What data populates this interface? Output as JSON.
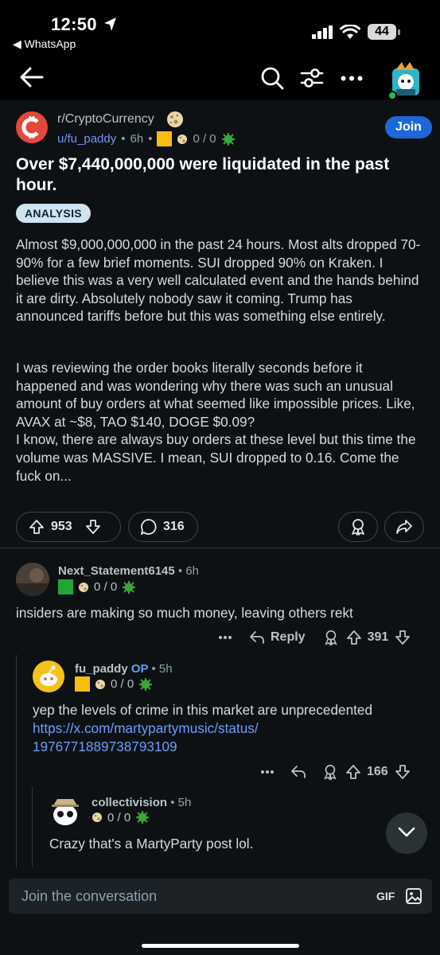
{
  "status_bar": {
    "time": "12:50",
    "back_app": "WhatsApp",
    "battery": "44"
  },
  "post": {
    "subreddit": "r/CryptoCurrency",
    "author": "u/fu_paddy",
    "age": "6h",
    "karma_flair": "0 / 0",
    "join_label": "Join",
    "title": "Over $7,440,000,000 were liquidated in the past hour.",
    "flair": "ANALYSIS",
    "paragraph_1": "Almost $9,000,000,000 in the past 24 hours. Most alts dropped 70-90% for a few brief moments. SUI dropped 90% on Kraken. I believe this was a very well calculated event and the hands behind it are dirty. Absolutely nobody saw it coming. Trump has announced tariffs before but this was something else entirely.",
    "paragraph_2a": "I was reviewing the order books literally seconds before it happened and was wondering why there was such an unusual amount of buy orders at what seemed like impossible prices. Like, AVAX at ~$8, TAO $140, DOGE $0.09?",
    "paragraph_2b": "I know, there are always buy orders at these level but this time the volume was MASSIVE. I mean, SUI dropped to 0.16. Come the fuck on...",
    "upvotes": "953",
    "comments": "316"
  },
  "comments": [
    {
      "author": "Next_Statement6145",
      "age": "6h",
      "karma_flair": "0 / 0",
      "text": "insiders are making so much money, leaving others rekt",
      "reply_label": "Reply",
      "votes": "391"
    },
    {
      "author": "fu_paddy",
      "op_label": "OP",
      "age": "5h",
      "karma_flair": "0 / 0",
      "text": "yep the levels of crime in this market are unprecedented",
      "link_1": "https://x.com/martypartymusic/status/",
      "link_2": "1976771889738793109",
      "votes": "166"
    },
    {
      "author": "collectivision",
      "age": "5h",
      "karma_flair": "0 / 0",
      "text": "Crazy that's a MartyParty post lol."
    }
  ],
  "composer": {
    "placeholder": "Join the conversation",
    "gif_label": "GIF"
  },
  "colors": {
    "background": "#0e1113",
    "join": "#1c68d8",
    "link": "#6b9dff",
    "flair": "#cfe3f0"
  }
}
